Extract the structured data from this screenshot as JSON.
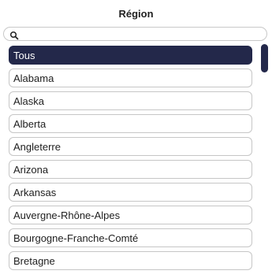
{
  "header": {
    "title": "Région"
  },
  "search": {
    "placeholder": "",
    "value": "",
    "icon": "search-icon"
  },
  "list": {
    "selected_index": 0,
    "items": [
      {
        "label": "Tous"
      },
      {
        "label": "Alabama"
      },
      {
        "label": "Alaska"
      },
      {
        "label": "Alberta"
      },
      {
        "label": "Angleterre"
      },
      {
        "label": "Arizona"
      },
      {
        "label": "Arkansas"
      },
      {
        "label": "Auvergne-Rhône-Alpes"
      },
      {
        "label": "Bourgogne-Franche-Comté"
      },
      {
        "label": "Bretagne"
      }
    ]
  },
  "colors": {
    "accent": "#23284a",
    "border": "#c6c6c6"
  }
}
